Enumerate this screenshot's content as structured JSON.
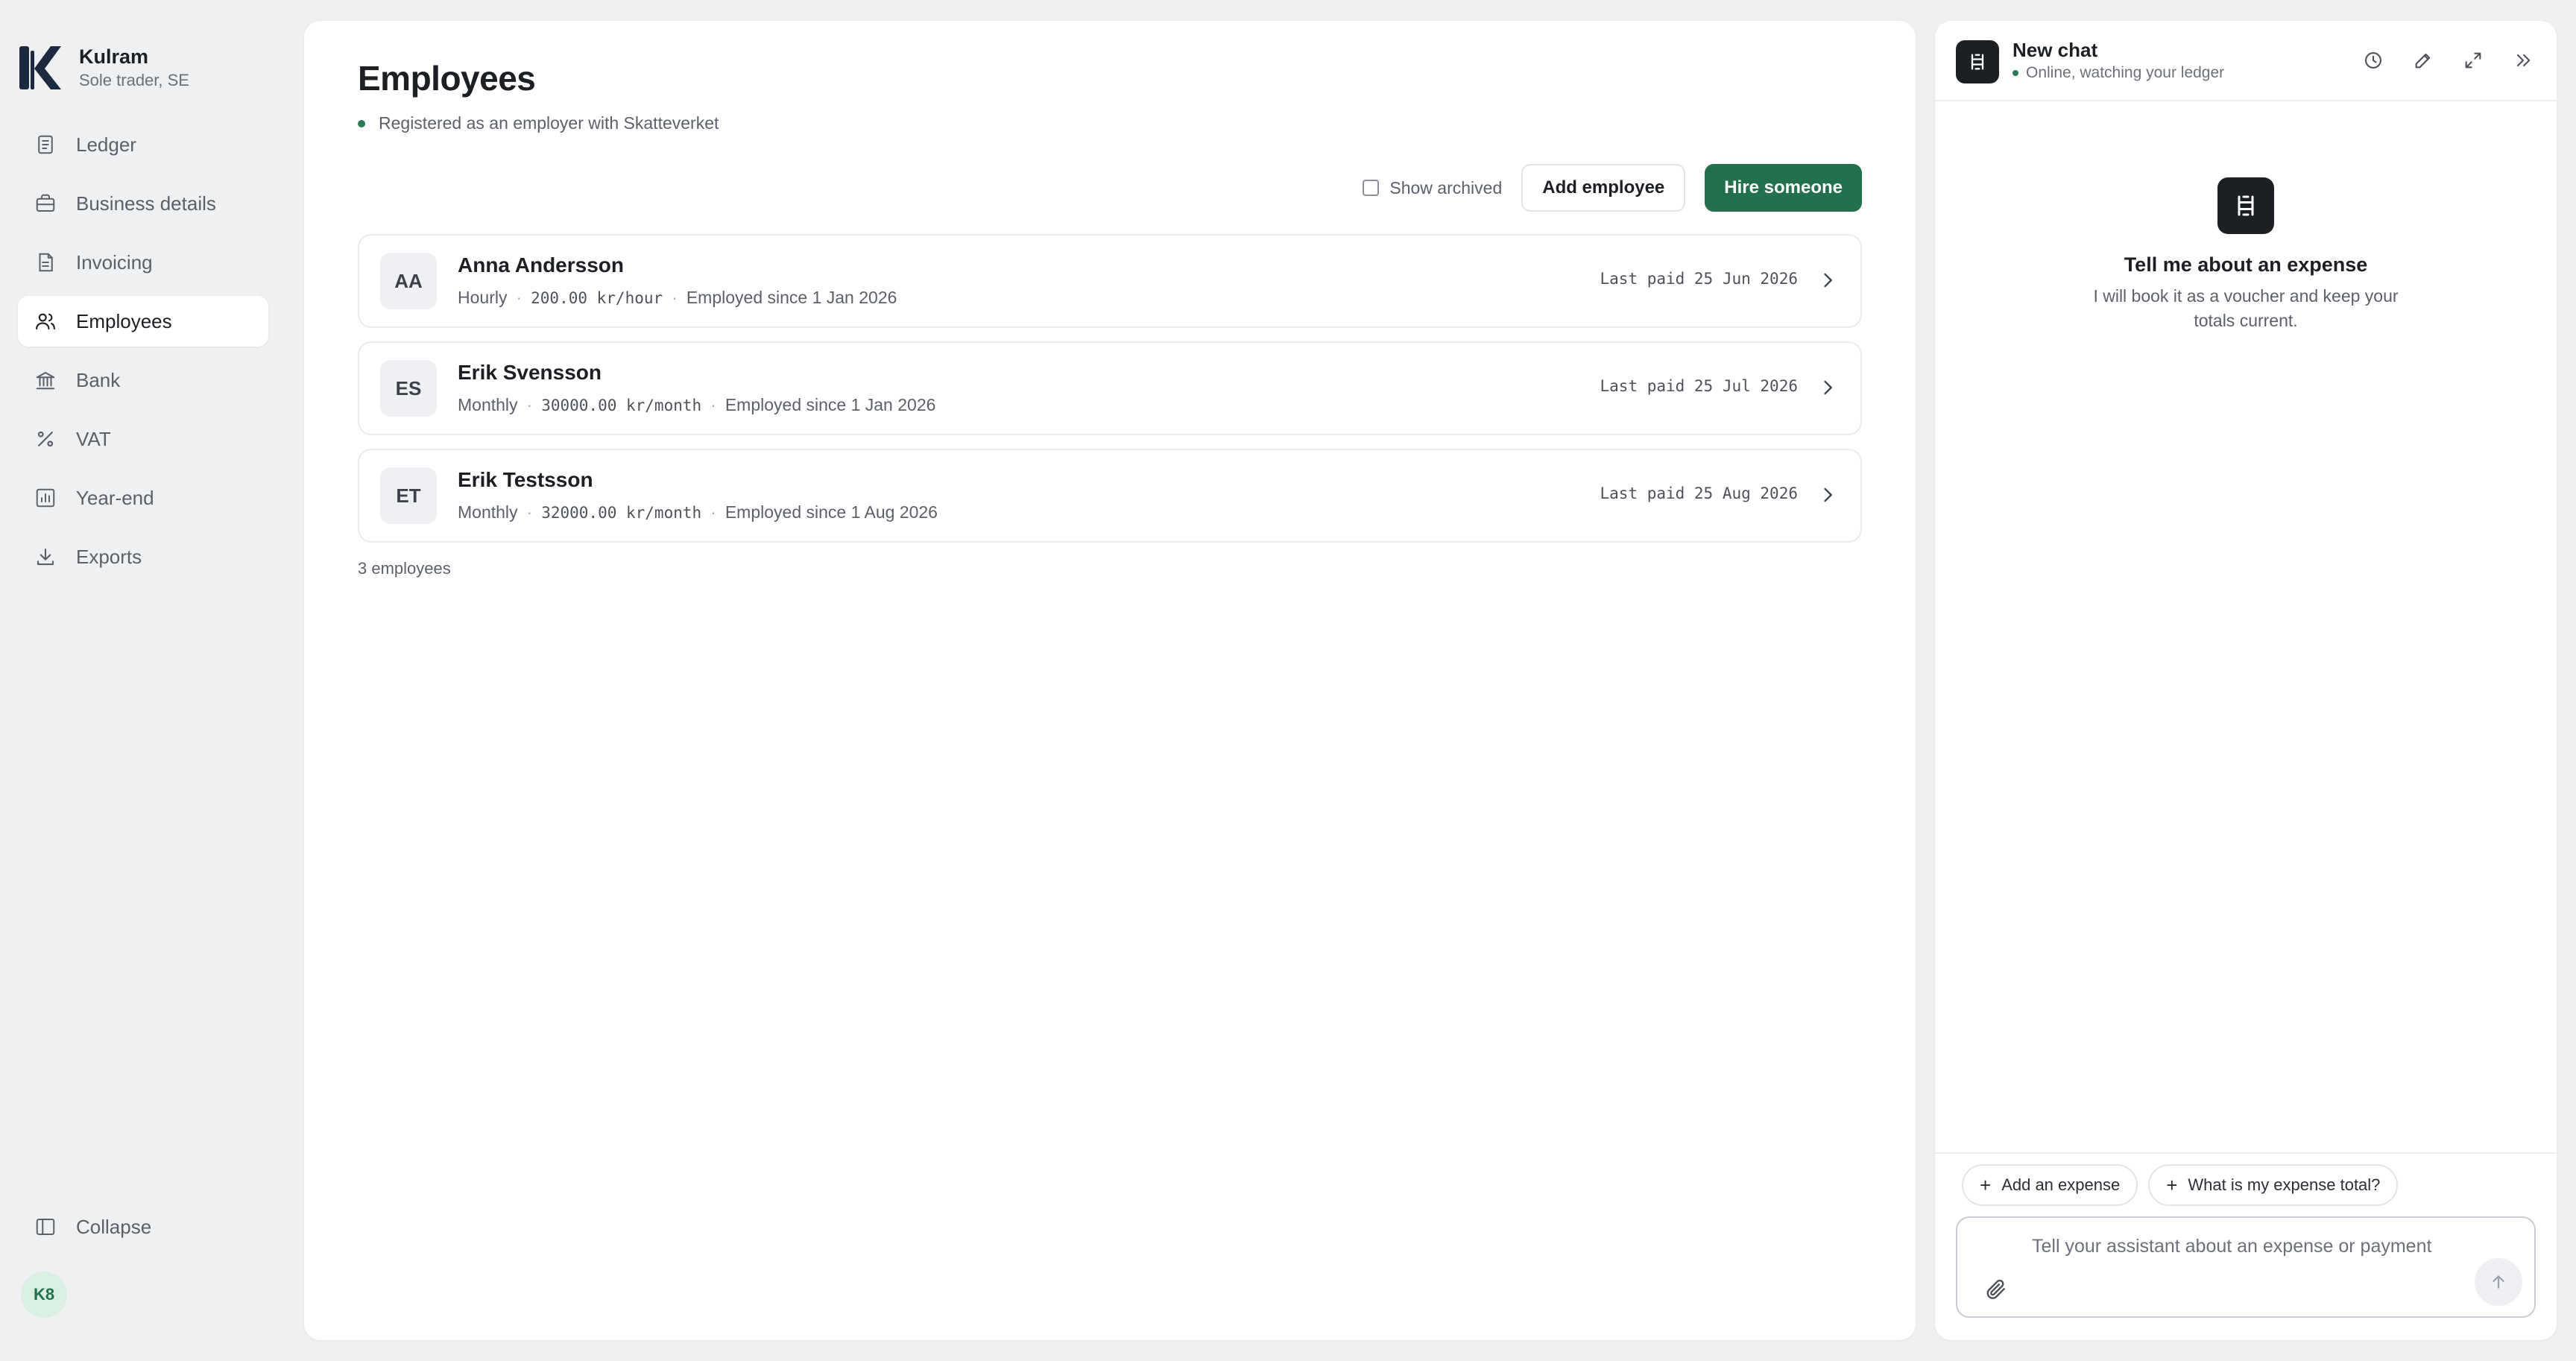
{
  "app": {
    "brand_name": "Kulram",
    "brand_sub": "Sole trader, SE",
    "user_initials": "K8"
  },
  "sidebar": {
    "items": [
      {
        "label": "Ledger",
        "icon": "ledger-icon"
      },
      {
        "label": "Business details",
        "icon": "briefcase-icon"
      },
      {
        "label": "Invoicing",
        "icon": "invoice-icon"
      },
      {
        "label": "Employees",
        "icon": "users-icon",
        "active": true
      },
      {
        "label": "Bank",
        "icon": "bank-icon"
      },
      {
        "label": "VAT",
        "icon": "percent-icon"
      },
      {
        "label": "Year-end",
        "icon": "chart-icon"
      },
      {
        "label": "Exports",
        "icon": "download-icon"
      }
    ],
    "collapse_label": "Collapse"
  },
  "main": {
    "title": "Employees",
    "status": "Registered as an employer with Skatteverket",
    "show_archived_label": "Show archived",
    "add_employee_label": "Add employee",
    "hire_label": "Hire someone",
    "employees": [
      {
        "initials": "AA",
        "name": "Anna Andersson",
        "pay_type": "Hourly",
        "rate": "200.00 kr/hour",
        "since": "Employed since 1 Jan 2026",
        "last_paid": "Last paid 25 Jun 2026"
      },
      {
        "initials": "ES",
        "name": "Erik Svensson",
        "pay_type": "Monthly",
        "rate": "30000.00 kr/month",
        "since": "Employed since 1 Jan 2026",
        "last_paid": "Last paid 25 Jul 2026"
      },
      {
        "initials": "ET",
        "name": "Erik Testsson",
        "pay_type": "Monthly",
        "rate": "32000.00 kr/month",
        "since": "Employed since 1 Aug 2026",
        "last_paid": "Last paid 25 Aug 2026"
      }
    ],
    "count_label": "3 employees"
  },
  "chat": {
    "title": "New chat",
    "status": "Online, watching your ledger",
    "empty_title": "Tell me about an expense",
    "empty_sub": "I will book it as a voucher and keep your totals current.",
    "suggestions": [
      "Add an expense",
      "What is my expense total?"
    ],
    "placeholder": "Tell your assistant about an expense or payment"
  },
  "colors": {
    "accent": "#23704c",
    "status_dot": "#2b7a55",
    "background": "#eef0f2"
  }
}
